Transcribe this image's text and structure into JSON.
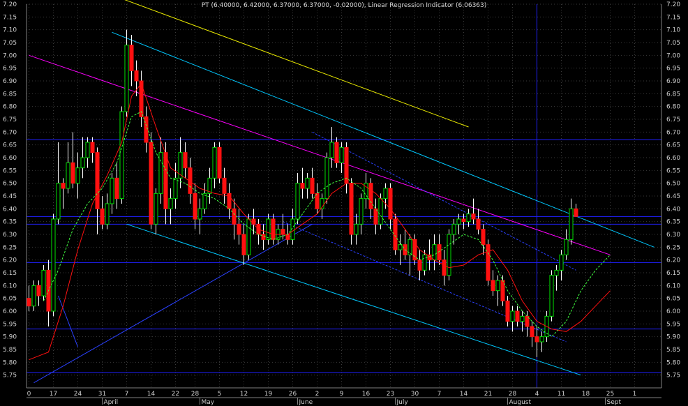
{
  "title": "PT (6.40000, 6.42000, 6.37000, 6.37000, -0.02000), Linear Regression Indicator (6.06363)",
  "colors": {
    "background": "#000000",
    "up_candle": "#00e000",
    "down_candle": "#ff1010",
    "wick": "#ffffff",
    "grid": "#3a3a3a",
    "axis_text": "#cfcfcf",
    "horizontal_lines": "#2020ff",
    "regression_line": "#ff00ff",
    "channel_lines": "#00c8ff",
    "top_line": "#e8e800",
    "moving_average": "#ff1010",
    "regression_indicator": "#40ff40",
    "trend_lines": "#2a40ff"
  },
  "chart_data": {
    "type": "candlestick",
    "title": "PT (6.40000, 6.42000, 6.37000, 6.37000, -0.02000), Linear Regression Indicator (6.06363)",
    "ylim": [
      5.7,
      7.2
    ],
    "y_ticks": [
      7.2,
      7.15,
      7.1,
      7.05,
      7.0,
      6.95,
      6.9,
      6.85,
      6.8,
      6.75,
      6.7,
      6.65,
      6.6,
      6.55,
      6.5,
      6.45,
      6.4,
      6.35,
      6.3,
      6.25,
      6.2,
      6.15,
      6.1,
      6.05,
      6.0,
      5.95,
      5.9,
      5.85,
      5.8,
      5.75
    ],
    "y_tick_labels": [
      "7.20",
      "7.15",
      "7.10",
      "7.05",
      "7.00",
      "6.95",
      "6.90",
      "6.85",
      "6.80",
      "6.75",
      "6.70",
      "6.65",
      "6.60",
      "6.55",
      "6.50",
      "6.45",
      "6.40",
      "6.35",
      "6.30",
      "6.25",
      "6.20",
      "6.15",
      "6.10",
      "6.05",
      "6.00",
      "5.95",
      "5.90",
      "5.85",
      "5.80",
      "5.75"
    ],
    "x_day_labels": [
      {
        "label": "0",
        "index": 0
      },
      {
        "label": "17",
        "index": 5
      },
      {
        "label": "24",
        "index": 10
      },
      {
        "label": "31",
        "index": 15
      },
      {
        "label": "7",
        "index": 20
      },
      {
        "label": "14",
        "index": 25
      },
      {
        "label": "22",
        "index": 30
      },
      {
        "label": "28",
        "index": 34
      },
      {
        "label": "5",
        "index": 39
      },
      {
        "label": "12",
        "index": 44
      },
      {
        "label": "19",
        "index": 49
      },
      {
        "label": "26",
        "index": 54
      },
      {
        "label": "2",
        "index": 59
      },
      {
        "label": "9",
        "index": 64
      },
      {
        "label": "16",
        "index": 69
      },
      {
        "label": "23",
        "index": 74
      },
      {
        "label": "30",
        "index": 79
      },
      {
        "label": "7",
        "index": 84
      },
      {
        "label": "14",
        "index": 89
      },
      {
        "label": "21",
        "index": 94
      },
      {
        "label": "28",
        "index": 99
      },
      {
        "label": "4",
        "index": 104
      },
      {
        "label": "11",
        "index": 109
      },
      {
        "label": "18",
        "index": 114
      },
      {
        "label": "25",
        "index": 119
      },
      {
        "label": "1",
        "index": 124
      }
    ],
    "x_month_labels": [
      {
        "label": "April",
        "index": 15
      },
      {
        "label": "May",
        "index": 35
      },
      {
        "label": "June",
        "index": 55
      },
      {
        "label": "July",
        "index": 75
      },
      {
        "label": "August",
        "index": 98
      },
      {
        "label": "Sept",
        "index": 118
      }
    ],
    "candles": [
      {
        "o": 6.05,
        "h": 6.1,
        "l": 6.0,
        "c": 6.02
      },
      {
        "o": 6.02,
        "h": 6.12,
        "l": 6.0,
        "c": 6.1
      },
      {
        "o": 6.1,
        "h": 6.12,
        "l": 6.02,
        "c": 6.06
      },
      {
        "o": 6.06,
        "h": 6.18,
        "l": 6.04,
        "c": 6.16
      },
      {
        "o": 6.16,
        "h": 6.2,
        "l": 5.94,
        "c": 6.0
      },
      {
        "o": 6.0,
        "h": 6.38,
        "l": 5.98,
        "c": 6.36
      },
      {
        "o": 6.36,
        "h": 6.66,
        "l": 6.34,
        "c": 6.5
      },
      {
        "o": 6.5,
        "h": 6.52,
        "l": 6.4,
        "c": 6.48
      },
      {
        "o": 6.48,
        "h": 6.66,
        "l": 6.46,
        "c": 6.58
      },
      {
        "o": 6.58,
        "h": 6.7,
        "l": 6.48,
        "c": 6.5
      },
      {
        "o": 6.5,
        "h": 6.62,
        "l": 6.44,
        "c": 6.56
      },
      {
        "o": 6.56,
        "h": 6.68,
        "l": 6.52,
        "c": 6.6
      },
      {
        "o": 6.6,
        "h": 6.68,
        "l": 6.56,
        "c": 6.66
      },
      {
        "o": 6.66,
        "h": 6.68,
        "l": 6.58,
        "c": 6.62
      },
      {
        "o": 6.62,
        "h": 6.64,
        "l": 6.3,
        "c": 6.4
      },
      {
        "o": 6.4,
        "h": 6.45,
        "l": 6.32,
        "c": 6.34
      },
      {
        "o": 6.34,
        "h": 6.46,
        "l": 6.32,
        "c": 6.42
      },
      {
        "o": 6.42,
        "h": 6.54,
        "l": 6.38,
        "c": 6.52
      },
      {
        "o": 6.52,
        "h": 6.58,
        "l": 6.4,
        "c": 6.44
      },
      {
        "o": 6.44,
        "h": 6.8,
        "l": 6.42,
        "c": 6.78
      },
      {
        "o": 6.78,
        "h": 7.1,
        "l": 6.76,
        "c": 7.04
      },
      {
        "o": 7.04,
        "h": 7.08,
        "l": 6.88,
        "c": 6.94
      },
      {
        "o": 6.94,
        "h": 6.98,
        "l": 6.84,
        "c": 6.9
      },
      {
        "o": 6.9,
        "h": 6.94,
        "l": 6.72,
        "c": 6.76
      },
      {
        "o": 6.76,
        "h": 6.8,
        "l": 6.62,
        "c": 6.66
      },
      {
        "o": 6.66,
        "h": 6.7,
        "l": 6.32,
        "c": 6.34
      },
      {
        "o": 6.34,
        "h": 6.48,
        "l": 6.3,
        "c": 6.46
      },
      {
        "o": 6.46,
        "h": 6.68,
        "l": 6.42,
        "c": 6.62
      },
      {
        "o": 6.62,
        "h": 6.66,
        "l": 6.34,
        "c": 6.4
      },
      {
        "o": 6.4,
        "h": 6.48,
        "l": 6.34,
        "c": 6.44
      },
      {
        "o": 6.44,
        "h": 6.58,
        "l": 6.4,
        "c": 6.52
      },
      {
        "o": 6.52,
        "h": 6.68,
        "l": 6.48,
        "c": 6.62
      },
      {
        "o": 6.62,
        "h": 6.66,
        "l": 6.52,
        "c": 6.56
      },
      {
        "o": 6.56,
        "h": 6.6,
        "l": 6.42,
        "c": 6.46
      },
      {
        "o": 6.46,
        "h": 6.5,
        "l": 6.32,
        "c": 6.36
      },
      {
        "o": 6.36,
        "h": 6.44,
        "l": 6.3,
        "c": 6.4
      },
      {
        "o": 6.4,
        "h": 6.5,
        "l": 6.38,
        "c": 6.46
      },
      {
        "o": 6.46,
        "h": 6.56,
        "l": 6.42,
        "c": 6.52
      },
      {
        "o": 6.52,
        "h": 6.66,
        "l": 6.48,
        "c": 6.64
      },
      {
        "o": 6.64,
        "h": 6.66,
        "l": 6.5,
        "c": 6.52
      },
      {
        "o": 6.52,
        "h": 6.56,
        "l": 6.42,
        "c": 6.46
      },
      {
        "o": 6.46,
        "h": 6.5,
        "l": 6.36,
        "c": 6.4
      },
      {
        "o": 6.4,
        "h": 6.44,
        "l": 6.28,
        "c": 6.34
      },
      {
        "o": 6.34,
        "h": 6.4,
        "l": 6.26,
        "c": 6.3
      },
      {
        "o": 6.3,
        "h": 6.34,
        "l": 6.18,
        "c": 6.22
      },
      {
        "o": 6.22,
        "h": 6.38,
        "l": 6.2,
        "c": 6.36
      },
      {
        "o": 6.36,
        "h": 6.4,
        "l": 6.3,
        "c": 6.34
      },
      {
        "o": 6.34,
        "h": 6.36,
        "l": 6.26,
        "c": 6.3
      },
      {
        "o": 6.3,
        "h": 6.34,
        "l": 6.24,
        "c": 6.28
      },
      {
        "o": 6.28,
        "h": 6.38,
        "l": 6.26,
        "c": 6.36
      },
      {
        "o": 6.36,
        "h": 6.38,
        "l": 6.26,
        "c": 6.28
      },
      {
        "o": 6.28,
        "h": 6.34,
        "l": 6.26,
        "c": 6.32
      },
      {
        "o": 6.32,
        "h": 6.38,
        "l": 6.28,
        "c": 6.3
      },
      {
        "o": 6.3,
        "h": 6.34,
        "l": 6.26,
        "c": 6.28
      },
      {
        "o": 6.28,
        "h": 6.4,
        "l": 6.26,
        "c": 6.36
      },
      {
        "o": 6.36,
        "h": 6.54,
        "l": 6.34,
        "c": 6.5
      },
      {
        "o": 6.5,
        "h": 6.56,
        "l": 6.44,
        "c": 6.48
      },
      {
        "o": 6.48,
        "h": 6.54,
        "l": 6.44,
        "c": 6.52
      },
      {
        "o": 6.52,
        "h": 6.56,
        "l": 6.44,
        "c": 6.46
      },
      {
        "o": 6.46,
        "h": 6.5,
        "l": 6.38,
        "c": 6.4
      },
      {
        "o": 6.4,
        "h": 6.46,
        "l": 6.36,
        "c": 6.44
      },
      {
        "o": 6.44,
        "h": 6.62,
        "l": 6.42,
        "c": 6.6
      },
      {
        "o": 6.6,
        "h": 6.72,
        "l": 6.56,
        "c": 6.66
      },
      {
        "o": 6.66,
        "h": 6.68,
        "l": 6.56,
        "c": 6.58
      },
      {
        "o": 6.58,
        "h": 6.66,
        "l": 6.54,
        "c": 6.64
      },
      {
        "o": 6.64,
        "h": 6.66,
        "l": 6.46,
        "c": 6.5
      },
      {
        "o": 6.5,
        "h": 6.52,
        "l": 6.26,
        "c": 6.3
      },
      {
        "o": 6.3,
        "h": 6.38,
        "l": 6.26,
        "c": 6.34
      },
      {
        "o": 6.34,
        "h": 6.46,
        "l": 6.3,
        "c": 6.44
      },
      {
        "o": 6.44,
        "h": 6.54,
        "l": 6.4,
        "c": 6.5
      },
      {
        "o": 6.5,
        "h": 6.52,
        "l": 6.36,
        "c": 6.4
      },
      {
        "o": 6.4,
        "h": 6.44,
        "l": 6.3,
        "c": 6.34
      },
      {
        "o": 6.34,
        "h": 6.46,
        "l": 6.32,
        "c": 6.44
      },
      {
        "o": 6.44,
        "h": 6.5,
        "l": 6.4,
        "c": 6.48
      },
      {
        "o": 6.48,
        "h": 6.5,
        "l": 6.32,
        "c": 6.36
      },
      {
        "o": 6.36,
        "h": 6.38,
        "l": 6.22,
        "c": 6.24
      },
      {
        "o": 6.24,
        "h": 6.3,
        "l": 6.18,
        "c": 6.26
      },
      {
        "o": 6.26,
        "h": 6.32,
        "l": 6.2,
        "c": 6.22
      },
      {
        "o": 6.22,
        "h": 6.3,
        "l": 6.14,
        "c": 6.28
      },
      {
        "o": 6.28,
        "h": 6.3,
        "l": 6.18,
        "c": 6.2
      },
      {
        "o": 6.2,
        "h": 6.24,
        "l": 6.12,
        "c": 6.16
      },
      {
        "o": 6.16,
        "h": 6.24,
        "l": 6.14,
        "c": 6.22
      },
      {
        "o": 6.22,
        "h": 6.28,
        "l": 6.16,
        "c": 6.2
      },
      {
        "o": 6.2,
        "h": 6.3,
        "l": 6.16,
        "c": 6.26
      },
      {
        "o": 6.26,
        "h": 6.3,
        "l": 6.18,
        "c": 6.2
      },
      {
        "o": 6.2,
        "h": 6.24,
        "l": 6.1,
        "c": 6.14
      },
      {
        "o": 6.14,
        "h": 6.32,
        "l": 6.12,
        "c": 6.3
      },
      {
        "o": 6.3,
        "h": 6.36,
        "l": 6.26,
        "c": 6.34
      },
      {
        "o": 6.34,
        "h": 6.38,
        "l": 6.3,
        "c": 6.36
      },
      {
        "o": 6.36,
        "h": 6.38,
        "l": 6.32,
        "c": 6.35
      },
      {
        "o": 6.35,
        "h": 6.4,
        "l": 6.33,
        "c": 6.38
      },
      {
        "o": 6.38,
        "h": 6.44,
        "l": 6.34,
        "c": 6.36
      },
      {
        "o": 6.36,
        "h": 6.4,
        "l": 6.3,
        "c": 6.32
      },
      {
        "o": 6.32,
        "h": 6.34,
        "l": 6.22,
        "c": 6.26
      },
      {
        "o": 6.26,
        "h": 6.28,
        "l": 6.1,
        "c": 6.12
      },
      {
        "o": 6.12,
        "h": 6.16,
        "l": 6.06,
        "c": 6.08
      },
      {
        "o": 6.08,
        "h": 6.14,
        "l": 6.02,
        "c": 6.12
      },
      {
        "o": 6.12,
        "h": 6.14,
        "l": 6.02,
        "c": 6.04
      },
      {
        "o": 6.04,
        "h": 6.06,
        "l": 5.94,
        "c": 5.96
      },
      {
        "o": 5.96,
        "h": 6.02,
        "l": 5.92,
        "c": 6.0
      },
      {
        "o": 6.0,
        "h": 6.02,
        "l": 5.94,
        "c": 5.96
      },
      {
        "o": 5.96,
        "h": 6.0,
        "l": 5.92,
        "c": 5.98
      },
      {
        "o": 5.98,
        "h": 6.0,
        "l": 5.9,
        "c": 5.94
      },
      {
        "o": 5.94,
        "h": 5.96,
        "l": 5.86,
        "c": 5.9
      },
      {
        "o": 5.9,
        "h": 5.94,
        "l": 5.82,
        "c": 5.88
      },
      {
        "o": 5.88,
        "h": 5.92,
        "l": 5.84,
        "c": 5.9
      },
      {
        "o": 5.9,
        "h": 6.0,
        "l": 5.88,
        "c": 5.98
      },
      {
        "o": 5.98,
        "h": 6.16,
        "l": 5.96,
        "c": 6.14
      },
      {
        "o": 6.14,
        "h": 6.18,
        "l": 6.08,
        "c": 6.16
      },
      {
        "o": 6.16,
        "h": 6.24,
        "l": 6.12,
        "c": 6.22
      },
      {
        "o": 6.22,
        "h": 6.32,
        "l": 6.2,
        "c": 6.28
      },
      {
        "o": 6.28,
        "h": 6.44,
        "l": 6.26,
        "c": 6.4
      },
      {
        "o": 6.4,
        "h": 6.42,
        "l": 6.37,
        "c": 6.37
      }
    ],
    "horizontal_levels": [
      6.67,
      6.37,
      6.34,
      6.19,
      5.93,
      5.76
    ],
    "moving_average": [
      [
        0,
        5.81
      ],
      [
        4,
        5.84
      ],
      [
        7,
        6.02
      ],
      [
        10,
        6.24
      ],
      [
        13,
        6.42
      ],
      [
        16,
        6.53
      ],
      [
        19,
        6.66
      ],
      [
        21,
        6.84
      ],
      [
        23,
        6.89
      ],
      [
        26,
        6.72
      ],
      [
        29,
        6.56
      ],
      [
        32,
        6.52
      ],
      [
        35,
        6.48
      ],
      [
        38,
        6.46
      ],
      [
        41,
        6.45
      ],
      [
        44,
        6.38
      ],
      [
        47,
        6.32
      ],
      [
        50,
        6.3
      ],
      [
        53,
        6.3
      ],
      [
        56,
        6.34
      ],
      [
        59,
        6.38
      ],
      [
        62,
        6.46
      ],
      [
        65,
        6.5
      ],
      [
        68,
        6.5
      ],
      [
        71,
        6.46
      ],
      [
        74,
        6.4
      ],
      [
        77,
        6.32
      ],
      [
        80,
        6.24
      ],
      [
        83,
        6.2
      ],
      [
        86,
        6.17
      ],
      [
        89,
        6.18
      ],
      [
        92,
        6.22
      ],
      [
        95,
        6.24
      ],
      [
        98,
        6.16
      ],
      [
        101,
        6.04
      ],
      [
        104,
        5.96
      ],
      [
        107,
        5.93
      ],
      [
        110,
        5.92
      ],
      [
        113,
        5.96
      ],
      [
        116,
        6.02
      ],
      [
        119,
        6.08
      ]
    ],
    "regression_indicator": [
      [
        3,
        6.04
      ],
      [
        6,
        6.16
      ],
      [
        9,
        6.32
      ],
      [
        12,
        6.42
      ],
      [
        15,
        6.48
      ],
      [
        18,
        6.58
      ],
      [
        21,
        6.76
      ],
      [
        23,
        6.78
      ],
      [
        26,
        6.62
      ],
      [
        29,
        6.52
      ],
      [
        32,
        6.5
      ],
      [
        35,
        6.46
      ],
      [
        38,
        6.44
      ],
      [
        41,
        6.4
      ],
      [
        44,
        6.34
      ],
      [
        47,
        6.3
      ],
      [
        50,
        6.28
      ],
      [
        53,
        6.3
      ],
      [
        56,
        6.38
      ],
      [
        59,
        6.46
      ],
      [
        62,
        6.5
      ],
      [
        65,
        6.52
      ],
      [
        68,
        6.48
      ],
      [
        71,
        6.4
      ],
      [
        74,
        6.32
      ],
      [
        77,
        6.24
      ],
      [
        80,
        6.2
      ],
      [
        83,
        6.22
      ],
      [
        86,
        6.26
      ],
      [
        89,
        6.3
      ],
      [
        92,
        6.28
      ],
      [
        95,
        6.2
      ],
      [
        98,
        6.08
      ],
      [
        101,
        6.0
      ],
      [
        104,
        5.94
      ],
      [
        107,
        5.9
      ],
      [
        110,
        5.96
      ],
      [
        113,
        6.08
      ],
      [
        116,
        6.16
      ],
      [
        119,
        6.22
      ]
    ],
    "regression_line": {
      "start": [
        0,
        7.0
      ],
      "end": [
        119,
        6.22
      ]
    },
    "upper_channel": {
      "start": [
        17,
        7.09
      ],
      "end": [
        128,
        6.25
      ]
    },
    "lower_channel": {
      "start": [
        20,
        6.34
      ],
      "end": [
        113,
        5.75
      ]
    },
    "top_trendline": {
      "start": [
        15,
        7.25
      ],
      "end": [
        90,
        6.72
      ]
    },
    "rising_trendline": {
      "start": [
        1,
        5.72
      ],
      "end": [
        58,
        6.34
      ]
    },
    "short_decline_line": {
      "start": [
        6,
        6.06
      ],
      "end": [
        10,
        5.86
      ]
    },
    "dashed_channel_upper": {
      "start": [
        58,
        6.7
      ],
      "end": [
        112,
        6.16
      ]
    },
    "dashed_channel_lower": {
      "start": [
        52,
        6.35
      ],
      "end": [
        110,
        5.88
      ]
    },
    "cursor_index": 104
  }
}
